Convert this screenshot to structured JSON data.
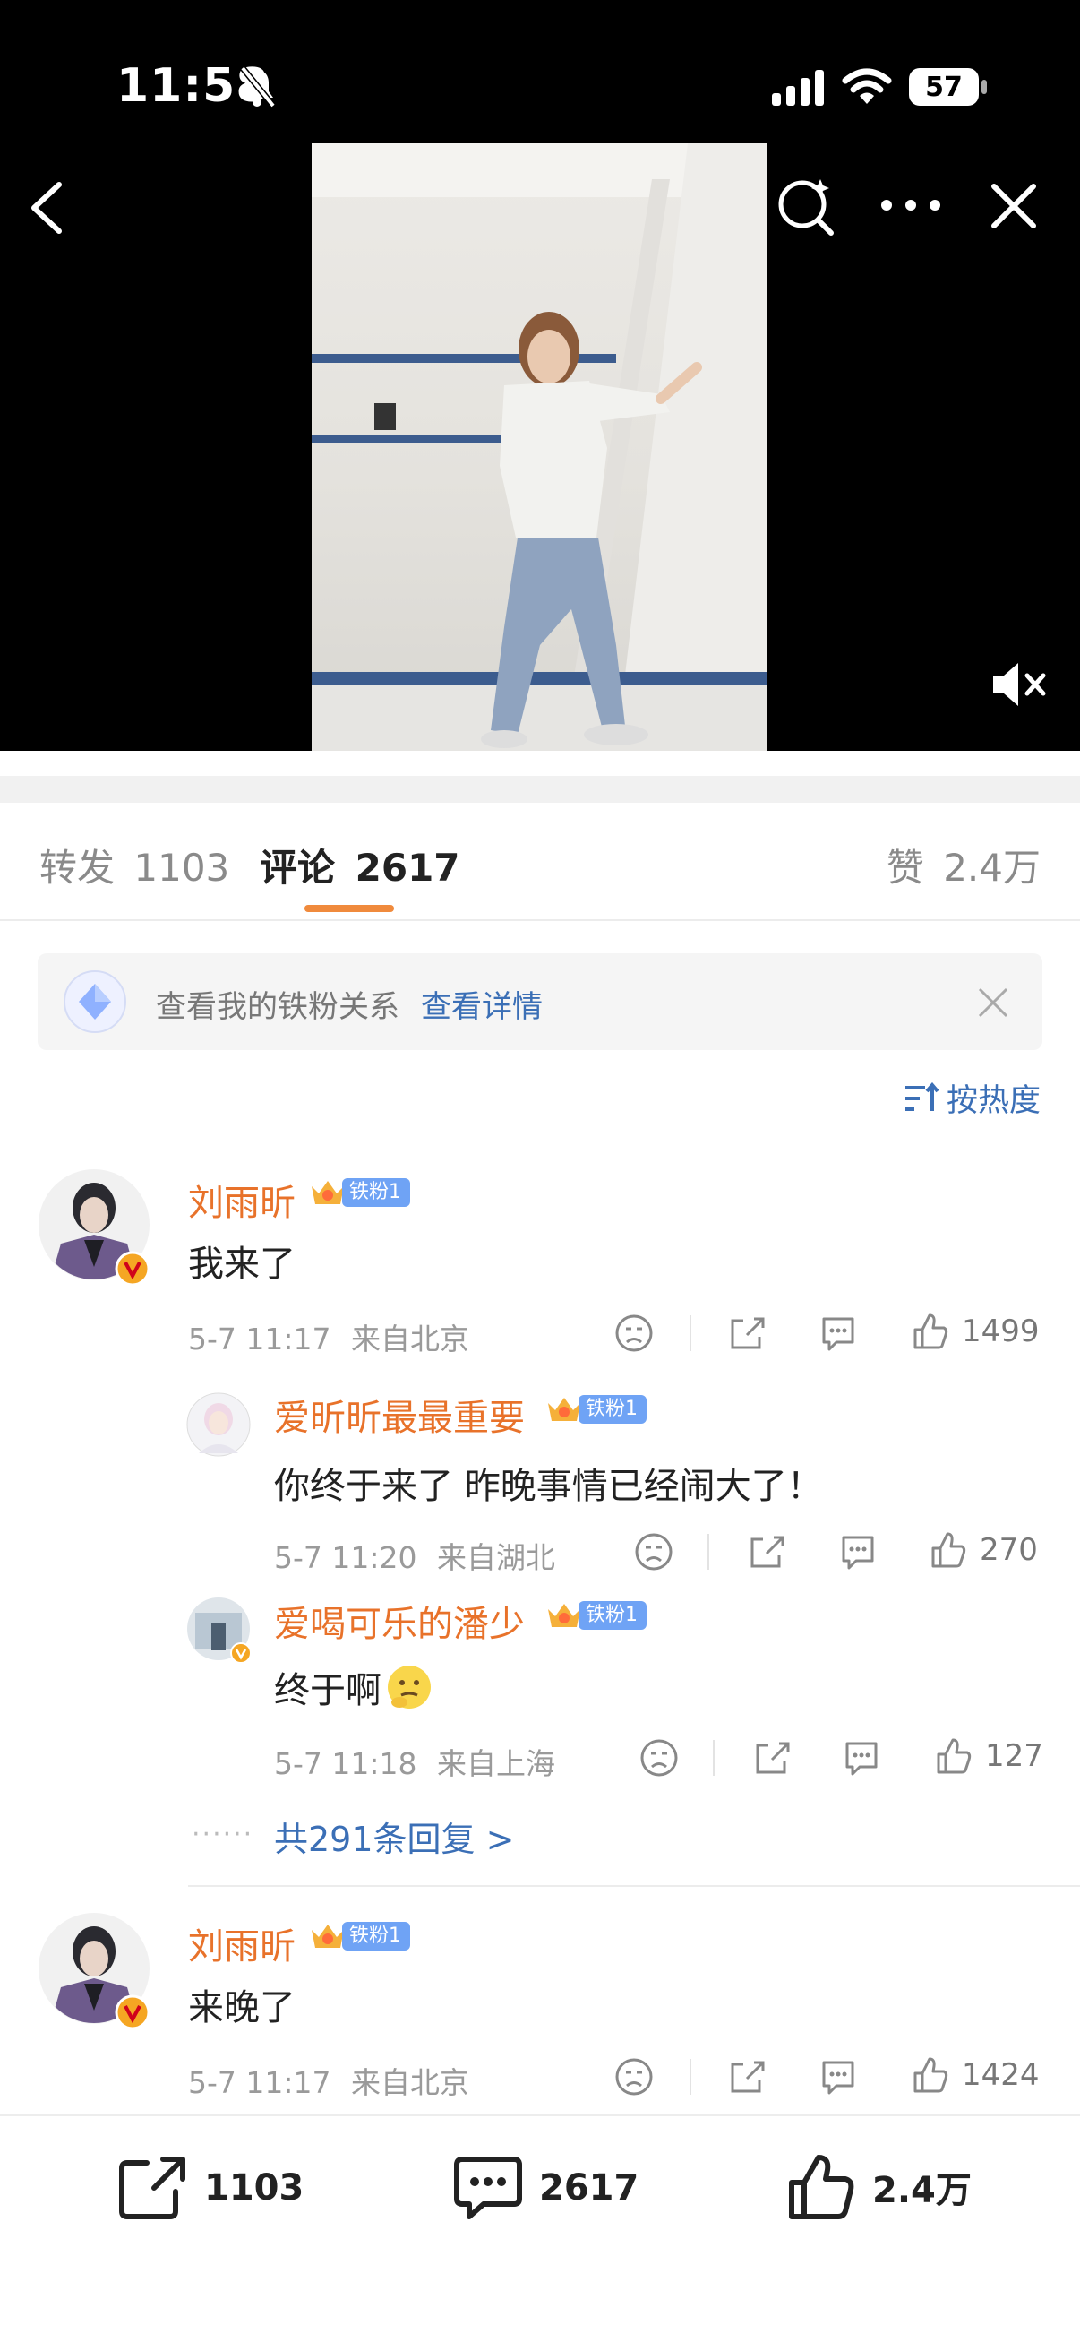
{
  "status_bar": {
    "time": "11:58",
    "battery": "57"
  },
  "tabs": {
    "repost_label": "转发",
    "repost_count": "1103",
    "comment_label": "评论",
    "comment_count": "2617",
    "like_label": "赞",
    "like_count": "2.4万"
  },
  "fan_banner": {
    "text": "查看我的铁粉关系",
    "link": "查看详情"
  },
  "sort": {
    "label": "按热度"
  },
  "comments": [
    {
      "user": "刘雨昕",
      "badge": "铁粉1",
      "text": "我来了",
      "date": "5-7 11:17",
      "location": "来自北京",
      "likes": "1499"
    },
    {
      "user": "刘雨昕",
      "badge": "铁粉1",
      "text": "来晚了",
      "date": "5-7 11:17",
      "location": "来自北京",
      "likes": "1424"
    }
  ],
  "replies": [
    {
      "user": "爱昕昕最最重要",
      "badge": "铁粉1",
      "text": "你终于来了 昨晚事情已经闹大了！",
      "date": "5-7 11:20",
      "location": "来自湖北",
      "likes": "270"
    },
    {
      "user": "爱喝可乐的潘少",
      "badge": "铁粉1",
      "text": "终于啊",
      "date": "5-7 11:18",
      "location": "来自上海",
      "likes": "127"
    }
  ],
  "more_replies": "共291条回复 >",
  "bottom_bar": {
    "repost": "1103",
    "comment": "2617",
    "like": "2.4万"
  },
  "colors": {
    "accent_orange": "#e8722a",
    "link_blue": "#3b6fb6",
    "badge_blue": "#6fa3f5"
  }
}
